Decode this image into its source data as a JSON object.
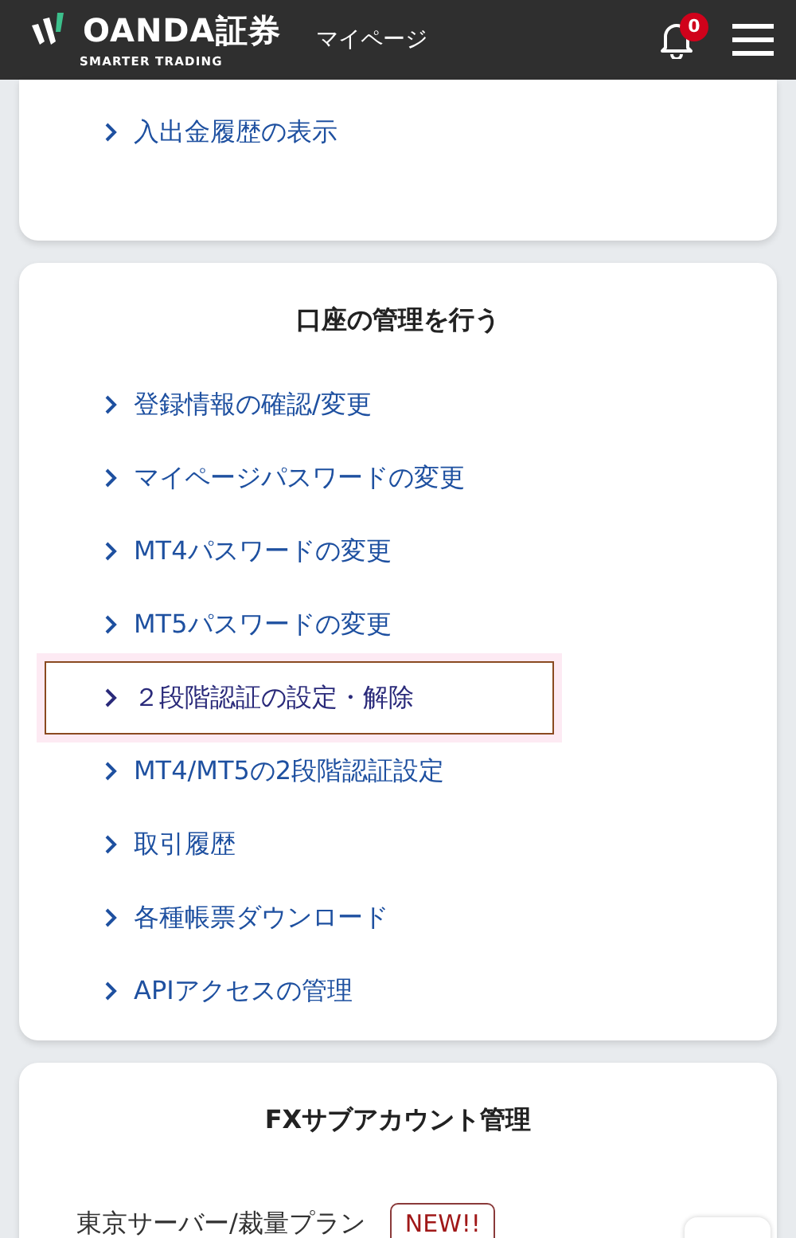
{
  "header": {
    "brand": "OANDA証券",
    "tagline": "SMARTER TRADING",
    "page_title": "マイページ",
    "notification_count": "0"
  },
  "sections": [
    {
      "items": [
        {
          "label": "入出金履歴の表示",
          "selected": false
        }
      ]
    },
    {
      "title": "口座の管理を行う",
      "items": [
        {
          "label": "登録情報の確認/変更",
          "selected": false
        },
        {
          "label": "マイページパスワードの変更",
          "selected": false
        },
        {
          "label": "MT4パスワードの変更",
          "selected": false
        },
        {
          "label": "MT5パスワードの変更",
          "selected": false
        },
        {
          "label": "２段階認証の設定・解除",
          "selected": true
        },
        {
          "label": "MT4/MT5の2段階認証設定",
          "selected": false
        },
        {
          "label": "取引履歴",
          "selected": false
        },
        {
          "label": "各種帳票ダウンロード",
          "selected": false
        },
        {
          "label": "APIアクセスの管理",
          "selected": false
        }
      ]
    },
    {
      "title": "FXサブアカウント管理",
      "plans": [
        {
          "label": "東京サーバー/裁量プラン",
          "badge": "NEW!!"
        }
      ]
    }
  ]
}
